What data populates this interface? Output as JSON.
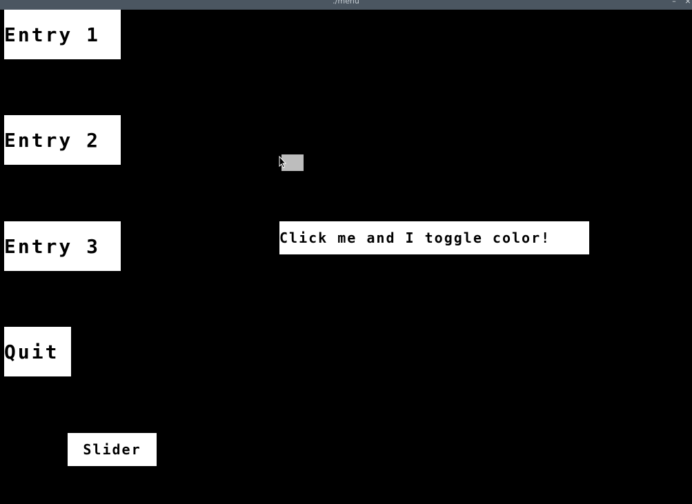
{
  "window": {
    "title": "./menu",
    "minimize_label": "–",
    "close_label": "×"
  },
  "menu": {
    "entries": [
      {
        "label": "Entry 1"
      },
      {
        "label": "Entry 2"
      },
      {
        "label": "Entry 3"
      }
    ],
    "quit_label": "Quit"
  },
  "toggle_button": {
    "label": "Click me and I toggle color!"
  },
  "slider_button": {
    "label": "Slider"
  },
  "colors": {
    "background": "#000000",
    "button_bg": "#ffffff",
    "button_text": "#000000",
    "titlebar": "#4b5661",
    "indicator": "#bdbdbd"
  }
}
